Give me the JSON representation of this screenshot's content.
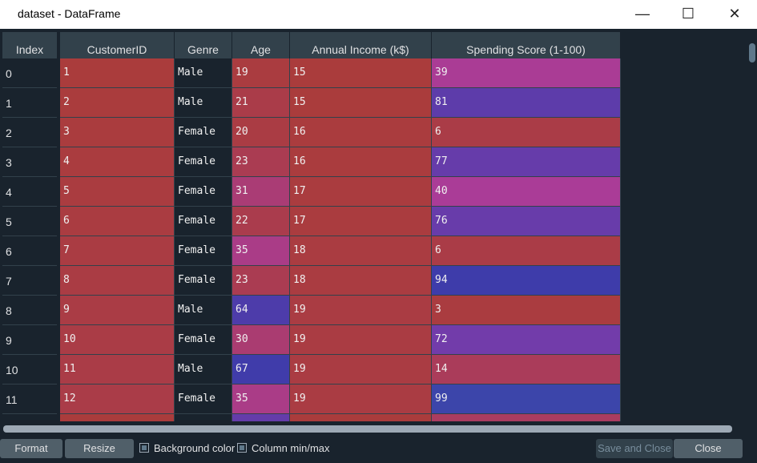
{
  "window": {
    "title": "dataset - DataFrame",
    "minimize_icon": "minimize-icon",
    "maximize_icon": "maximize-icon",
    "close_icon": "close-icon"
  },
  "table": {
    "index_header": "Index",
    "columns": [
      "CustomerID",
      "Genre",
      "Age",
      "Annual Income (k$)",
      "Spending Score (1-100)"
    ],
    "rows": [
      {
        "index": "0",
        "values": [
          "1",
          "Male",
          "19",
          "15",
          "39"
        ]
      },
      {
        "index": "1",
        "values": [
          "2",
          "Male",
          "21",
          "15",
          "81"
        ]
      },
      {
        "index": "2",
        "values": [
          "3",
          "Female",
          "20",
          "16",
          "6"
        ]
      },
      {
        "index": "3",
        "values": [
          "4",
          "Female",
          "23",
          "16",
          "77"
        ]
      },
      {
        "index": "4",
        "values": [
          "5",
          "Female",
          "31",
          "17",
          "40"
        ]
      },
      {
        "index": "5",
        "values": [
          "6",
          "Female",
          "22",
          "17",
          "76"
        ]
      },
      {
        "index": "6",
        "values": [
          "7",
          "Female",
          "35",
          "18",
          "6"
        ]
      },
      {
        "index": "7",
        "values": [
          "8",
          "Female",
          "23",
          "18",
          "94"
        ]
      },
      {
        "index": "8",
        "values": [
          "9",
          "Male",
          "64",
          "19",
          "3"
        ]
      },
      {
        "index": "9",
        "values": [
          "10",
          "Female",
          "30",
          "19",
          "72"
        ]
      },
      {
        "index": "10",
        "values": [
          "11",
          "Male",
          "67",
          "19",
          "14"
        ]
      },
      {
        "index": "11",
        "values": [
          "12",
          "Female",
          "35",
          "19",
          "99"
        ]
      }
    ]
  },
  "footer": {
    "format_label": "Format",
    "resize_label": "Resize",
    "background_color_label": "Background color",
    "column_minmax_label": "Column min/max",
    "save_close_label": "Save and Close",
    "close_label": "Close"
  }
}
